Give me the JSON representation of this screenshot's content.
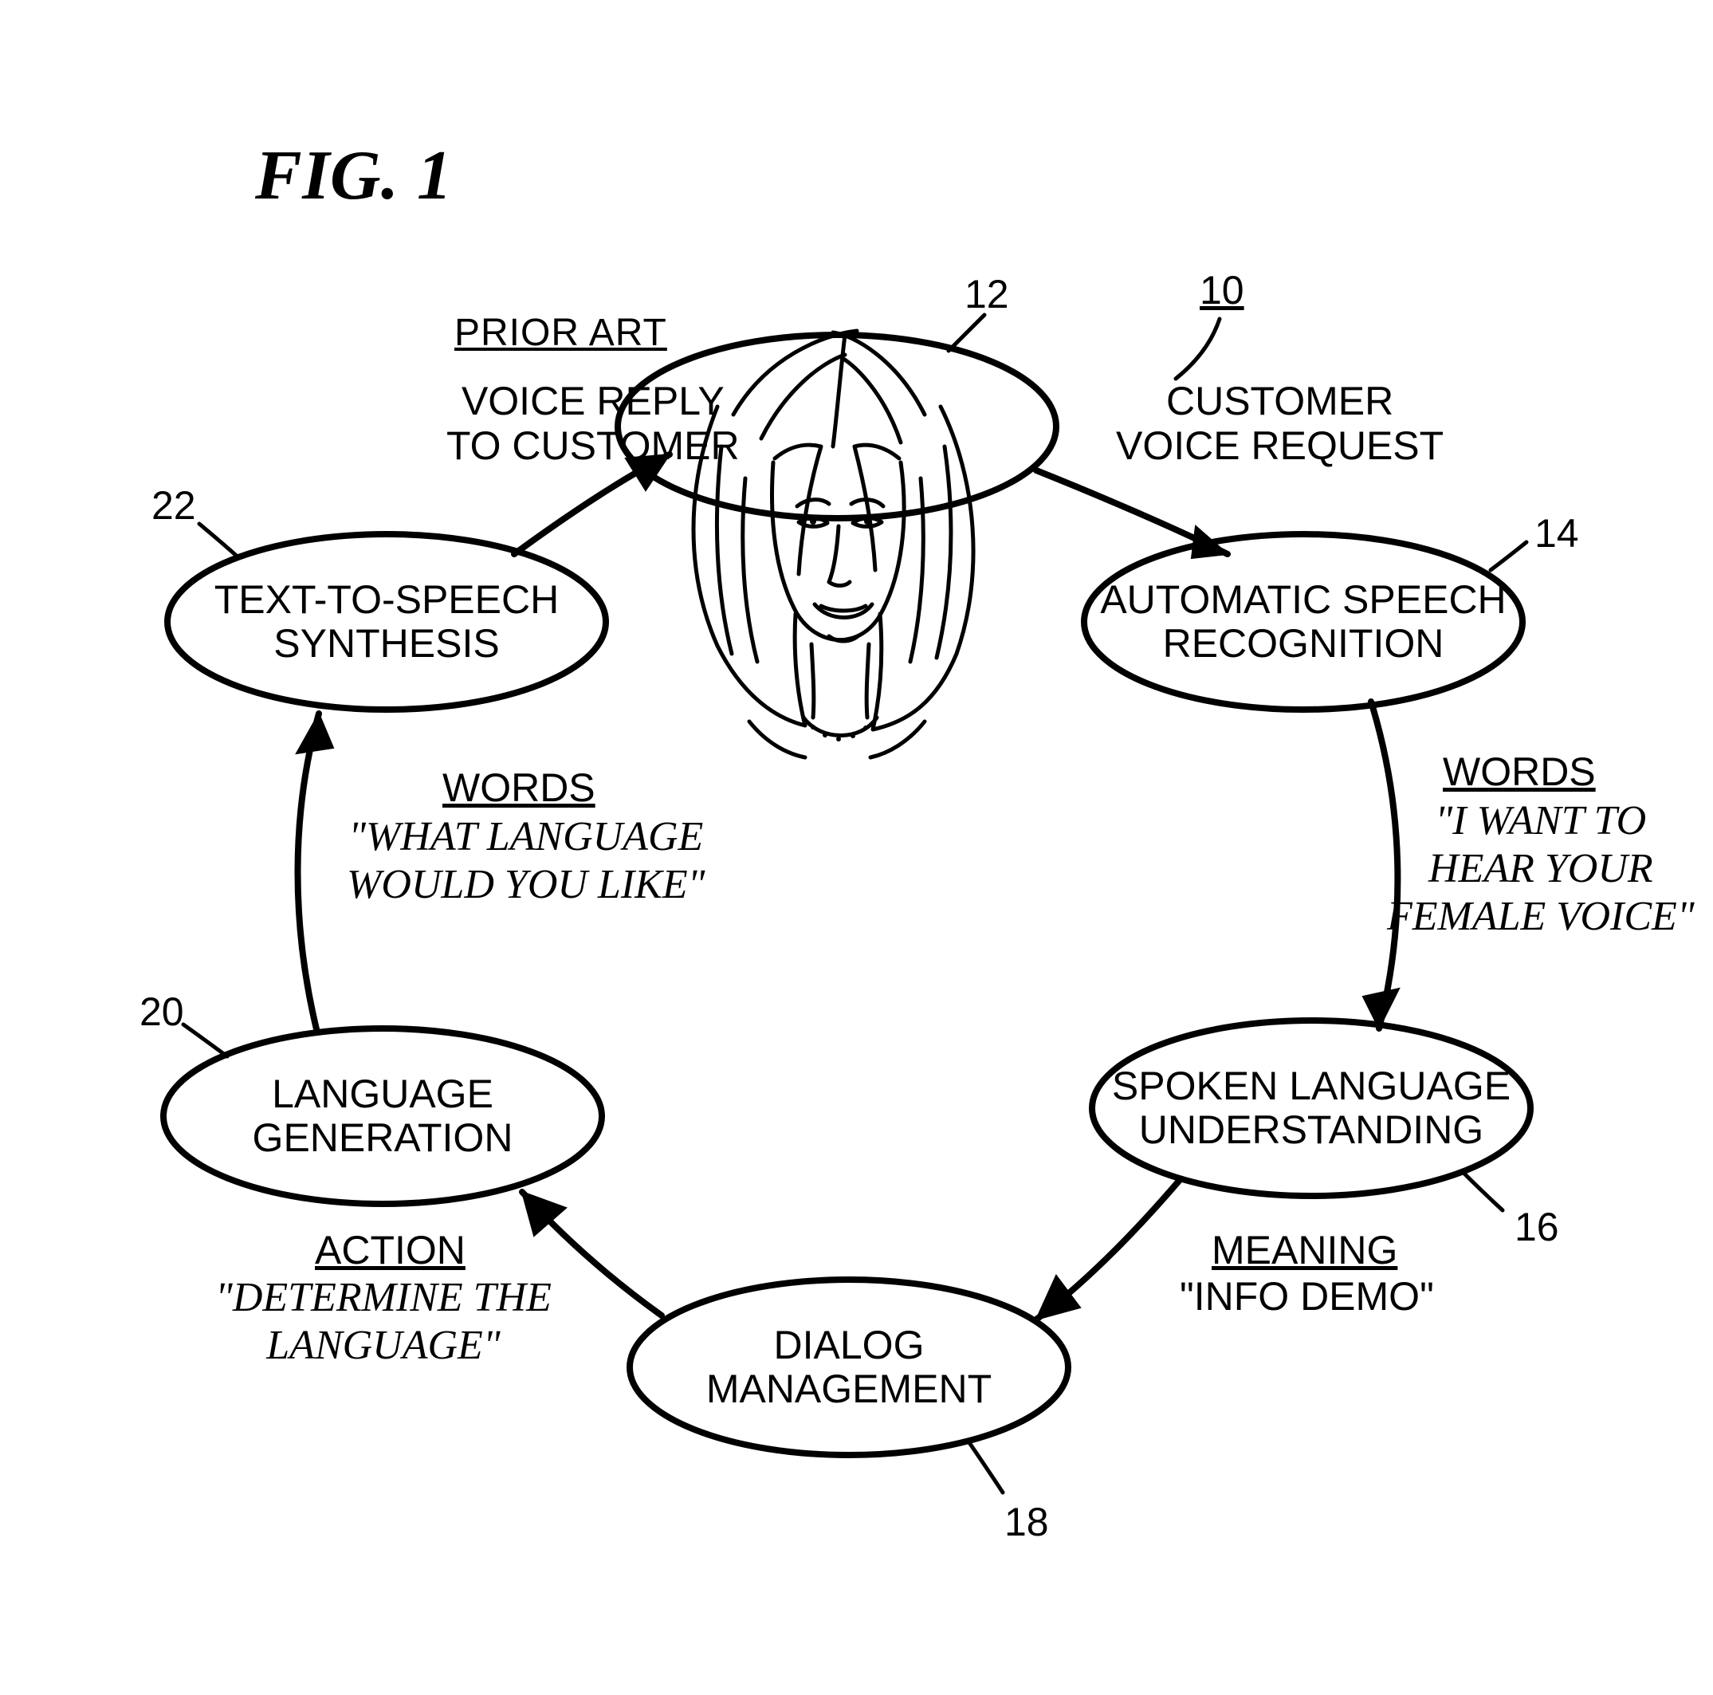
{
  "figure": {
    "title": "FIG. 1",
    "prior_art": "PRIOR ART"
  },
  "refs": {
    "r10": "10",
    "r12": "12",
    "r14": "14",
    "r16": "16",
    "r18": "18",
    "r20": "20",
    "r22": "22"
  },
  "nodes": {
    "tts": "TEXT-TO-SPEECH\nSYNTHESIS",
    "asr": "AUTOMATIC SPEECH\nRECOGNITION",
    "slu": "SPOKEN LANGUAGE\nUNDERSTANDING",
    "dm": "DIALOG\nMANAGEMENT",
    "lg": "LANGUAGE\nGENERATION"
  },
  "edge_labels": {
    "voice_reply": "VOICE REPLY\nTO CUSTOMER",
    "customer_req": "CUSTOMER\nVOICE REQUEST",
    "words_right_hdr": "WORDS",
    "words_right_quote": "\"I WANT TO\nHEAR YOUR\nFEMALE VOICE\"",
    "meaning_hdr": "MEANING",
    "meaning_val": "\"INFO DEMO\"",
    "action_hdr": "ACTION",
    "action_quote": "\"DETERMINE THE\nLANGUAGE\"",
    "words_left_hdr": "WORDS",
    "words_left_quote": "\"WHAT LANGUAGE\nWOULD YOU LIKE\""
  }
}
